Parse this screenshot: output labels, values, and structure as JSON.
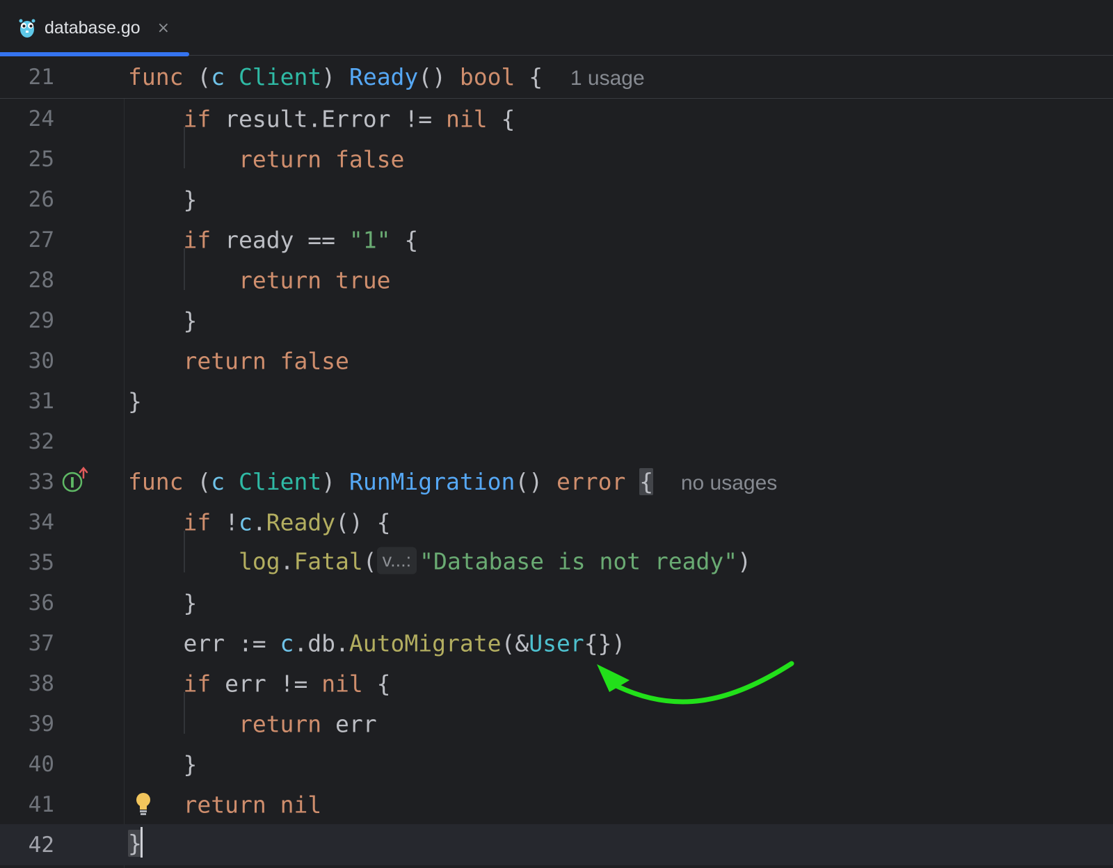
{
  "tab": {
    "filename": "database.go",
    "close_glyph": "×",
    "icon": "gopher-icon"
  },
  "sticky": {
    "number": "21",
    "tokens": [
      {
        "t": "func",
        "c": "kw"
      },
      {
        "t": " ("
      },
      {
        "t": "c",
        "c": "rcv"
      },
      {
        "t": " "
      },
      {
        "t": "Client",
        "c": "ty"
      },
      {
        "t": ") "
      },
      {
        "t": "Ready",
        "c": "fn"
      },
      {
        "t": "() "
      },
      {
        "t": "bool",
        "c": "kw"
      },
      {
        "t": " {  "
      },
      {
        "t": "1 usage",
        "c": "hint"
      }
    ]
  },
  "lines": [
    {
      "n": "24",
      "tokens": [
        {
          "t": "    "
        },
        {
          "t": "if",
          "c": "kw"
        },
        {
          "t": " result.Error != "
        },
        {
          "t": "nil",
          "c": "kw"
        },
        {
          "t": " {"
        }
      ]
    },
    {
      "n": "25",
      "tokens": [
        {
          "t": "        "
        },
        {
          "t": "return",
          "c": "kw"
        },
        {
          "t": " "
        },
        {
          "t": "false",
          "c": "kw"
        }
      ]
    },
    {
      "n": "26",
      "tokens": [
        {
          "t": "    }"
        }
      ]
    },
    {
      "n": "27",
      "tokens": [
        {
          "t": "    "
        },
        {
          "t": "if",
          "c": "kw"
        },
        {
          "t": " ready == "
        },
        {
          "t": "\"1\"",
          "c": "str"
        },
        {
          "t": " {"
        }
      ]
    },
    {
      "n": "28",
      "tokens": [
        {
          "t": "        "
        },
        {
          "t": "return",
          "c": "kw"
        },
        {
          "t": " "
        },
        {
          "t": "true",
          "c": "kw"
        }
      ]
    },
    {
      "n": "29",
      "tokens": [
        {
          "t": "    }"
        }
      ]
    },
    {
      "n": "30",
      "tokens": [
        {
          "t": "    "
        },
        {
          "t": "return",
          "c": "kw"
        },
        {
          "t": " "
        },
        {
          "t": "false",
          "c": "kw"
        }
      ]
    },
    {
      "n": "31",
      "tokens": [
        {
          "t": "}"
        }
      ]
    },
    {
      "n": "32",
      "tokens": []
    },
    {
      "n": "33",
      "icon": "implements-interface-icon",
      "tokens": [
        {
          "t": "func",
          "c": "kw"
        },
        {
          "t": " ("
        },
        {
          "t": "c",
          "c": "rcv"
        },
        {
          "t": " "
        },
        {
          "t": "Client",
          "c": "ty"
        },
        {
          "t": ") "
        },
        {
          "t": "RunMigration",
          "c": "fn"
        },
        {
          "t": "() "
        },
        {
          "t": "error",
          "c": "kw"
        },
        {
          "t": " "
        },
        {
          "t": "{",
          "c": "brace-hl"
        },
        {
          "t": "  "
        },
        {
          "t": "no usages",
          "c": "hint"
        }
      ]
    },
    {
      "n": "34",
      "tokens": [
        {
          "t": "    "
        },
        {
          "t": "if",
          "c": "kw"
        },
        {
          "t": " !"
        },
        {
          "t": "c",
          "c": "rcv"
        },
        {
          "t": "."
        },
        {
          "t": "Ready",
          "c": "call"
        },
        {
          "t": "() {"
        }
      ]
    },
    {
      "n": "35",
      "tokens": [
        {
          "t": "        "
        },
        {
          "t": "log",
          "c": "call"
        },
        {
          "t": "."
        },
        {
          "t": "Fatal",
          "c": "call"
        },
        {
          "t": "("
        },
        {
          "t": "v...:",
          "c": "param-hint"
        },
        {
          "t": "\"Database is not ready\"",
          "c": "str"
        },
        {
          "t": ")"
        }
      ]
    },
    {
      "n": "36",
      "tokens": [
        {
          "t": "    }"
        }
      ]
    },
    {
      "n": "37",
      "tokens": [
        {
          "t": "    err := "
        },
        {
          "t": "c",
          "c": "rcv"
        },
        {
          "t": ".db."
        },
        {
          "t": "AutoMigrate",
          "c": "call"
        },
        {
          "t": "(&"
        },
        {
          "t": "User",
          "c": "struct"
        },
        {
          "t": "{})"
        }
      ]
    },
    {
      "n": "38",
      "tokens": [
        {
          "t": "    "
        },
        {
          "t": "if",
          "c": "kw"
        },
        {
          "t": " err != "
        },
        {
          "t": "nil",
          "c": "kw"
        },
        {
          "t": " {"
        }
      ]
    },
    {
      "n": "39",
      "tokens": [
        {
          "t": "        "
        },
        {
          "t": "return",
          "c": "kw"
        },
        {
          "t": " err"
        }
      ]
    },
    {
      "n": "40",
      "tokens": [
        {
          "t": "    }"
        }
      ]
    },
    {
      "n": "41",
      "icon": "lightbulb-icon",
      "tokens": [
        {
          "t": "    "
        },
        {
          "t": "return",
          "c": "kw"
        },
        {
          "t": " "
        },
        {
          "t": "nil",
          "c": "kw"
        }
      ]
    },
    {
      "n": "42",
      "current": true,
      "caret": true,
      "tokens": [
        {
          "t": "}",
          "c": "brace-hl"
        }
      ]
    }
  ],
  "annotation": {
    "icon": "green-arrow-icon",
    "color": "#22e01a"
  }
}
